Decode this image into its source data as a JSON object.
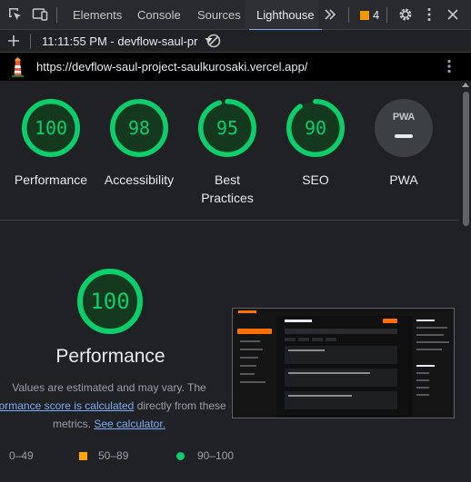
{
  "devtools": {
    "tabs": [
      "Elements",
      "Console",
      "Sources",
      "Lighthouse"
    ],
    "active_tab": "Lighthouse",
    "overflow_label": "»",
    "issues_count": "4",
    "accent": "#7cacf8"
  },
  "toolbar": {
    "report_label": "11:11:55 PM - devflow-saul-pr"
  },
  "url_bar": {
    "url": "https://devflow-saul-project-saulkurosaki.vercel.app/"
  },
  "scores": [
    {
      "label": "Performance",
      "score": "100",
      "value": 100
    },
    {
      "label": "Accessibility",
      "score": "98",
      "value": 98
    },
    {
      "label": "Best Practices",
      "score": "95",
      "value": 95
    },
    {
      "label": "SEO",
      "score": "90",
      "value": 90
    }
  ],
  "pwa": {
    "label": "PWA",
    "badge": "PWA"
  },
  "colors": {
    "pass": "#0cce6b",
    "average": "#ffa400",
    "fail": "#ff4e42",
    "pass_track": "#14391f"
  },
  "category": {
    "score": "100",
    "value": 100,
    "title": "Performance",
    "note_prefix": "Values are estimated and may vary. The",
    "note_link": "rformance score is calculated",
    "note_middle": "directly from these",
    "note_suffix_prefix": "metrics.",
    "note_link2": "See calculator."
  },
  "legend": {
    "fail": "0–49",
    "average": "50–89",
    "pass": "90–100"
  }
}
